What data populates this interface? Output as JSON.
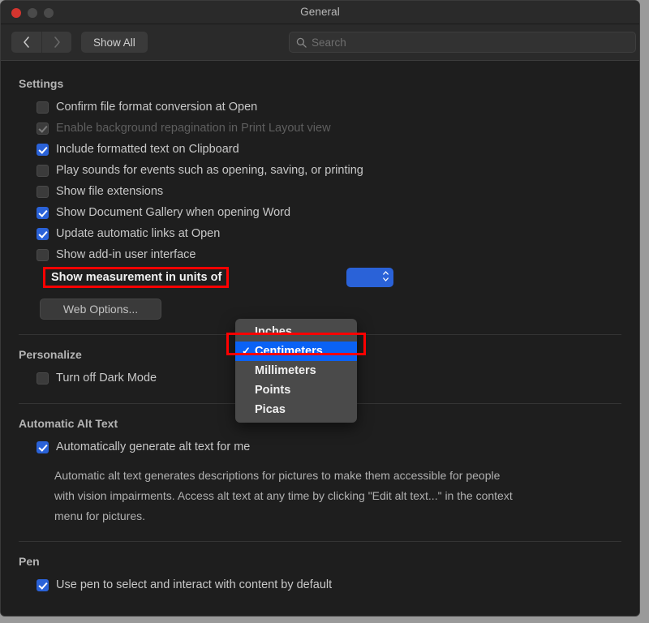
{
  "window": {
    "title": "General",
    "traffic_lights": [
      "close-button",
      "minimize-button",
      "maximize-button"
    ]
  },
  "toolbar": {
    "back_label": "Back",
    "forward_label": "Forward",
    "show_all_label": "Show All",
    "search_placeholder": "Search",
    "search_value": ""
  },
  "colors": {
    "accent_blue": "#2a62d8",
    "menu_highlight": "#0a62f5",
    "annotation_red": "#ff0000",
    "window_bg": "#1e1e1e",
    "chrome_bg": "#2a2a2a"
  },
  "sections": {
    "settings": {
      "title": "Settings",
      "items": [
        {
          "label": "Confirm file format conversion at Open",
          "checked": false,
          "disabled": false
        },
        {
          "label": "Enable background repagination in Print Layout view",
          "checked": true,
          "disabled": true
        },
        {
          "label": "Include formatted text on Clipboard",
          "checked": true,
          "disabled": false
        },
        {
          "label": "Play sounds for events such as opening, saving, or printing",
          "checked": false,
          "disabled": false
        },
        {
          "label": "Show file extensions",
          "checked": false,
          "disabled": false
        },
        {
          "label": "Show Document Gallery when opening Word",
          "checked": true,
          "disabled": false
        },
        {
          "label": "Update automatic links at Open",
          "checked": true,
          "disabled": false
        },
        {
          "label": "Show add-in user interface",
          "checked": false,
          "disabled": false
        }
      ],
      "units_row": {
        "label": "Show measurement in units of",
        "selected_value": "Centimeters",
        "highlighted": true
      },
      "web_options_label": "Web Options..."
    },
    "personalize": {
      "title": "Personalize",
      "items": [
        {
          "label": "Turn off Dark Mode",
          "checked": false,
          "disabled": false
        }
      ]
    },
    "automatic_alt_text": {
      "title": "Automatic Alt Text",
      "items": [
        {
          "label": "Automatically generate alt text for me",
          "checked": true,
          "disabled": false
        }
      ],
      "description": "Automatic alt text generates descriptions for pictures to make them accessible for people with vision impairments. Access alt text at any time by clicking \"Edit alt text...\" in the context menu for pictures."
    },
    "pen": {
      "title": "Pen",
      "items": [
        {
          "label": "Use pen to select and interact with content by default",
          "checked": true,
          "disabled": false
        }
      ]
    }
  },
  "units_menu": {
    "open": true,
    "options": [
      {
        "label": "Inches",
        "selected": false
      },
      {
        "label": "Centimeters",
        "selected": true
      },
      {
        "label": "Millimeters",
        "selected": false
      },
      {
        "label": "Points",
        "selected": false
      },
      {
        "label": "Picas",
        "selected": false
      }
    ],
    "check_glyph": "✓"
  }
}
